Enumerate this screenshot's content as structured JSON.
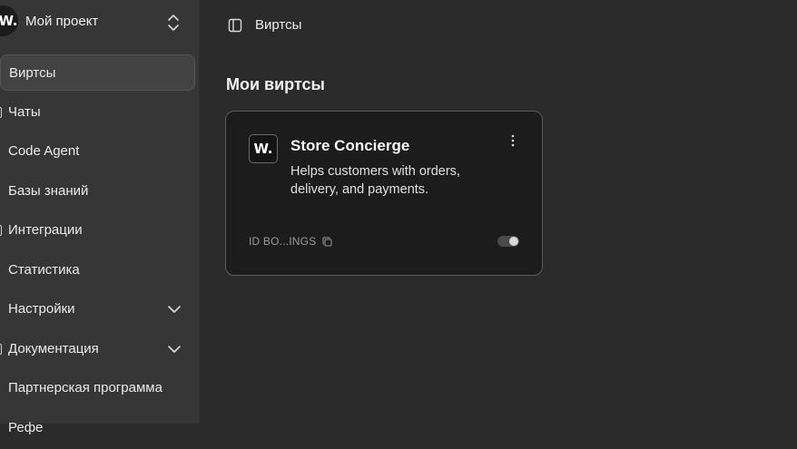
{
  "project": {
    "logo_text": "W.",
    "name": "Мой проект"
  },
  "sidebar": {
    "items": [
      {
        "label": "Виртсы",
        "active": true,
        "expandable": false
      },
      {
        "label": "Чаты",
        "active": false,
        "expandable": false
      },
      {
        "label": "Code Agent",
        "active": false,
        "expandable": false
      },
      {
        "label": "Базы знаний",
        "active": false,
        "expandable": false
      },
      {
        "label": "Интеграции",
        "active": false,
        "expandable": false
      },
      {
        "label": "Статистика",
        "active": false,
        "expandable": false
      },
      {
        "label": "Настройки",
        "active": false,
        "expandable": true
      },
      {
        "label": "Документация",
        "active": false,
        "expandable": true
      },
      {
        "label": "Партнерская программа",
        "active": false,
        "expandable": false
      },
      {
        "label": "Рефе",
        "active": false,
        "expandable": false
      }
    ]
  },
  "header": {
    "breadcrumb": "Виртсы"
  },
  "main": {
    "title": "Мои виртсы",
    "cards": [
      {
        "logo_text": "W.",
        "title": "Store Concierge",
        "description": "Helps customers with orders, delivery, and payments.",
        "id_label": "ID BO...INGS",
        "enabled": true
      }
    ]
  },
  "colors": {
    "background": "#2b2b2c",
    "sidebar": "#363637",
    "card": "#1c1c1d",
    "active_item": "#434344"
  }
}
